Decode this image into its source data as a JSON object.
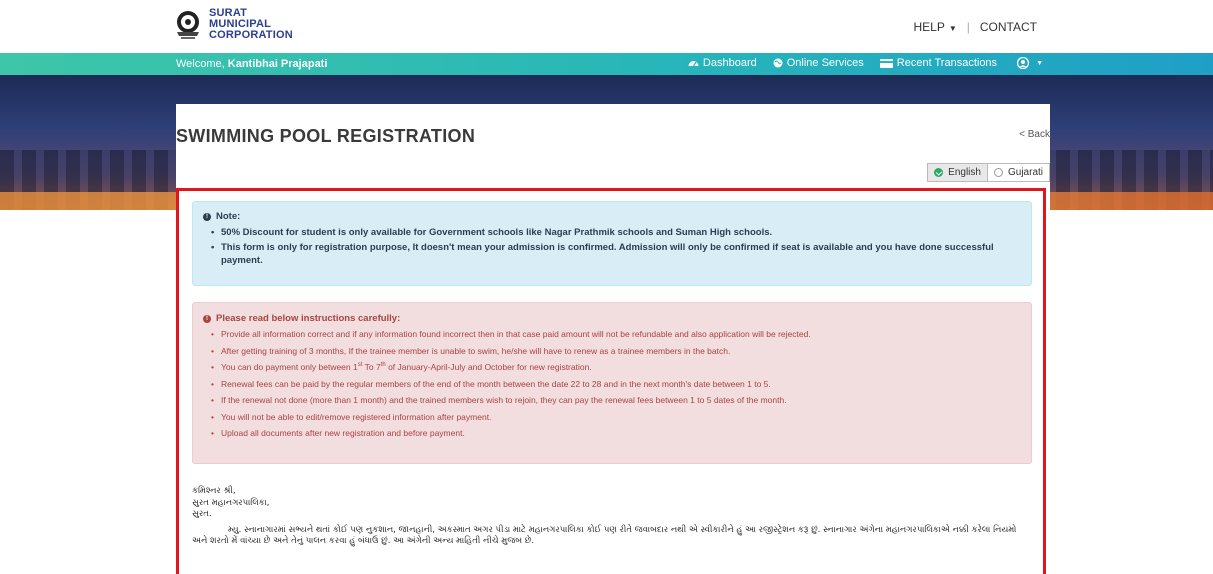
{
  "header": {
    "logo_lines": [
      "SURAT",
      "MUNICIPAL",
      "CORPORATION"
    ],
    "help_label": "HELP",
    "contact_label": "CONTACT"
  },
  "navbar": {
    "welcome_prefix": "Welcome, ",
    "user_name": "Kantibhai Prajapati",
    "items": [
      {
        "label": "Dashboard",
        "icon": "dashboard-icon"
      },
      {
        "label": "Online Services",
        "icon": "globe-icon"
      },
      {
        "label": "Recent Transactions",
        "icon": "card-icon"
      }
    ],
    "account_icon": "user-circle-icon"
  },
  "page": {
    "title": "SWIMMING POOL REGISTRATION",
    "back_label": "< Back",
    "languages": {
      "english": "English",
      "gujarati": "Gujarati",
      "selected": "English"
    }
  },
  "note": {
    "heading": "Note:",
    "items": [
      "50% Discount for student is only available for Government schools like Nagar Prathmik schools and Suman High schools.",
      "This form is only for registration purpose, It doesn't mean your admission is confirmed. Admission will only be confirmed if seat is available and you have done successful payment."
    ]
  },
  "instructions": {
    "heading": "Please read below instructions carefully:",
    "items": [
      "Provide all information correct and if any information found incorrect then in that case paid amount will not be refundable and also application will be rejected.",
      "After getting training of 3 months, If the trainee member is unable to swim, he/she will have to renew as a trainee members in the batch.",
      {
        "pre": "You can do payment only between 1",
        "sup1": "st",
        "mid": " To 7",
        "sup2": "th",
        "post": " of January-April-July and October for new registration."
      },
      "Renewal fees can be paid by the regular members of the end of the month between the date 22 to 28 and in the next month's date between 1 to 5.",
      "If the renewal not done (more than 1 month) and the trained members wish to rejoin, they can pay the renewal fees between 1 to 5 dates of the month.",
      "You will not be able to edit/remove registered information after payment.",
      "Upload all documents after new registration and before payment."
    ]
  },
  "gujarati": {
    "line1": "કમિશ્નર શ્રી,",
    "line2": "સુરત મહાનગરપાલિકા,",
    "line3": "સુરત.",
    "para": "મ્યુ. સ્નાનાગારમાં સભ્યને થતાં કોઈ પણ નુકશાન, જાનહાની, અકસ્માત અગર પીડા માટે મહાનગરપાલિકા કોઈ પણ રીતે જવાબદાર નથી એ સ્વીકારીને હું આ રજીસ્ટ્રેશન કરૂ છું. સ્નાનાગાર અંગેના મહાનગરપાલિકાએ નક્કી કરેલા નિયમો અને શરતો મેં વાંચ્યા છે અને તેનું પાલન કરવા હું બંધાઉ છું. આ અંગેની અન્ય માહિતી નીચે મુજબ છે."
  },
  "colors": {
    "highlight_border": "#e3141b",
    "note_bg": "#d9edf7",
    "warn_bg": "#f2dede",
    "nav_gradient_start": "#3fc6a8",
    "nav_gradient_end": "#1f9fc6"
  }
}
